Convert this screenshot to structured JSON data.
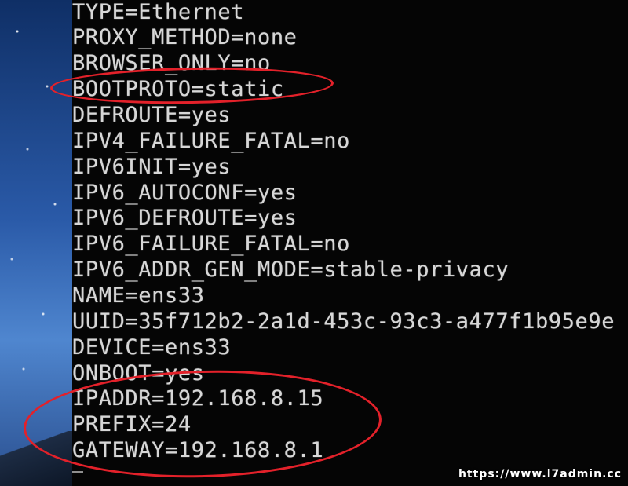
{
  "terminal": {
    "lines": [
      "TYPE=Ethernet",
      "PROXY_METHOD=none",
      "BROWSER_ONLY=no",
      "BOOTPROTO=static",
      "DEFROUTE=yes",
      "IPV4_FAILURE_FATAL=no",
      "IPV6INIT=yes",
      "IPV6_AUTOCONF=yes",
      "IPV6_DEFROUTE=yes",
      "IPV6_FAILURE_FATAL=no",
      "IPV6_ADDR_GEN_MODE=stable-privacy",
      "NAME=ens33",
      "UUID=35f712b2-2a1d-453c-93c3-a477f1b95e9e",
      "DEVICE=ens33",
      "ONBOOT=yes",
      "IPADDR=192.168.8.15",
      "PREFIX=24",
      "GATEWAY=192.168.8.1"
    ]
  },
  "watermark": "https://www.l7admin.cc",
  "colors": {
    "text": "#d7d7d7",
    "background": "#050505",
    "annotation": "#e3212a"
  }
}
